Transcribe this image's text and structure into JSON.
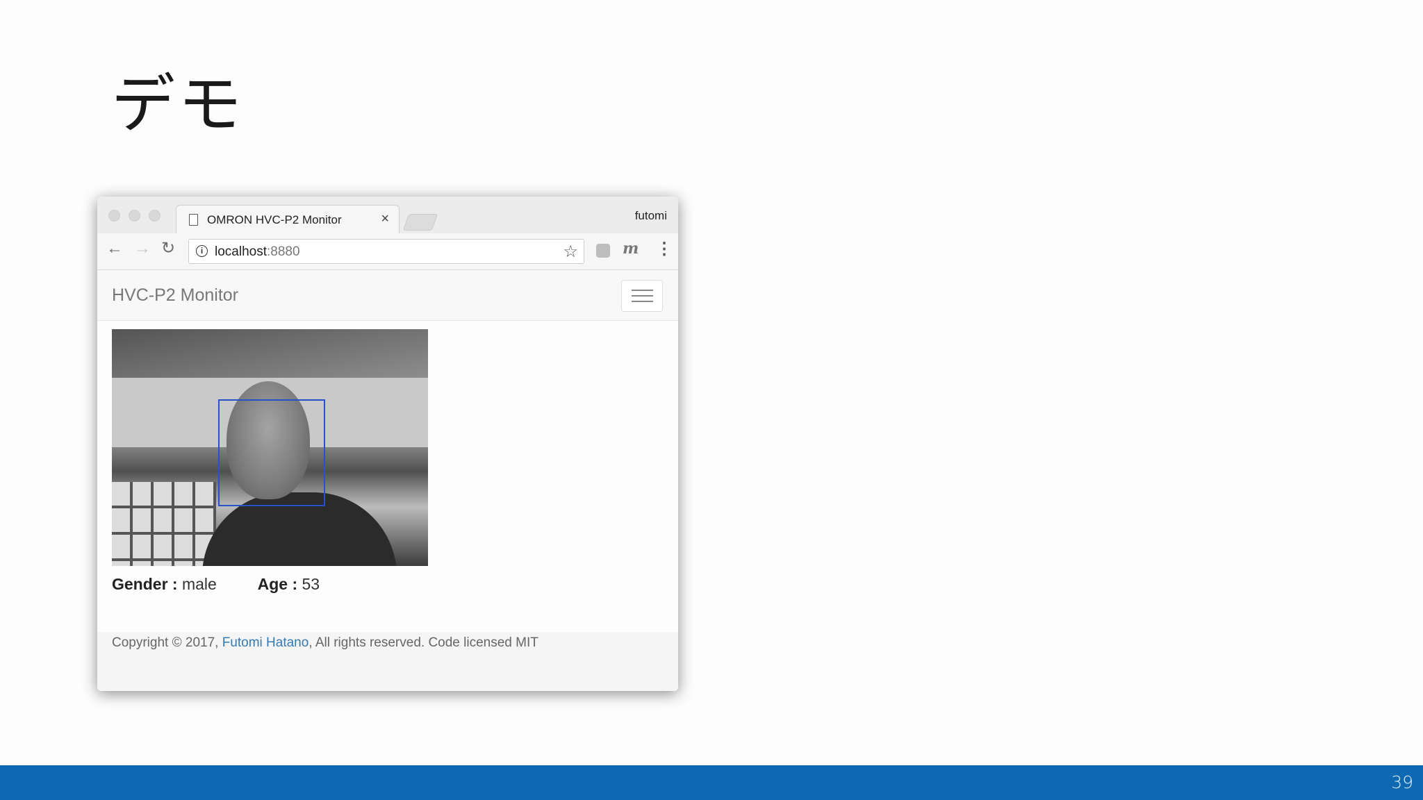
{
  "slide": {
    "title": "デモ",
    "page_number": "39"
  },
  "browser": {
    "tab_title": "OMRON HVC-P2 Monitor",
    "tab_close": "×",
    "profile_name": "futomi",
    "url_host": "localhost",
    "url_port": ":8880"
  },
  "app": {
    "brand": "HVC-P2 Monitor",
    "gender_label": "Gender :",
    "gender_value": "male",
    "age_label": "Age :",
    "age_value": "53",
    "footer": {
      "prefix": "Copyright © 2017, ",
      "author_link": "Futomi Hatano",
      "suffix": ", All rights reserved. Code licensed MIT"
    }
  },
  "colors": {
    "bottom_bar": "#0e69b2",
    "face_box": "#2a4fc7",
    "link": "#337ab7"
  }
}
